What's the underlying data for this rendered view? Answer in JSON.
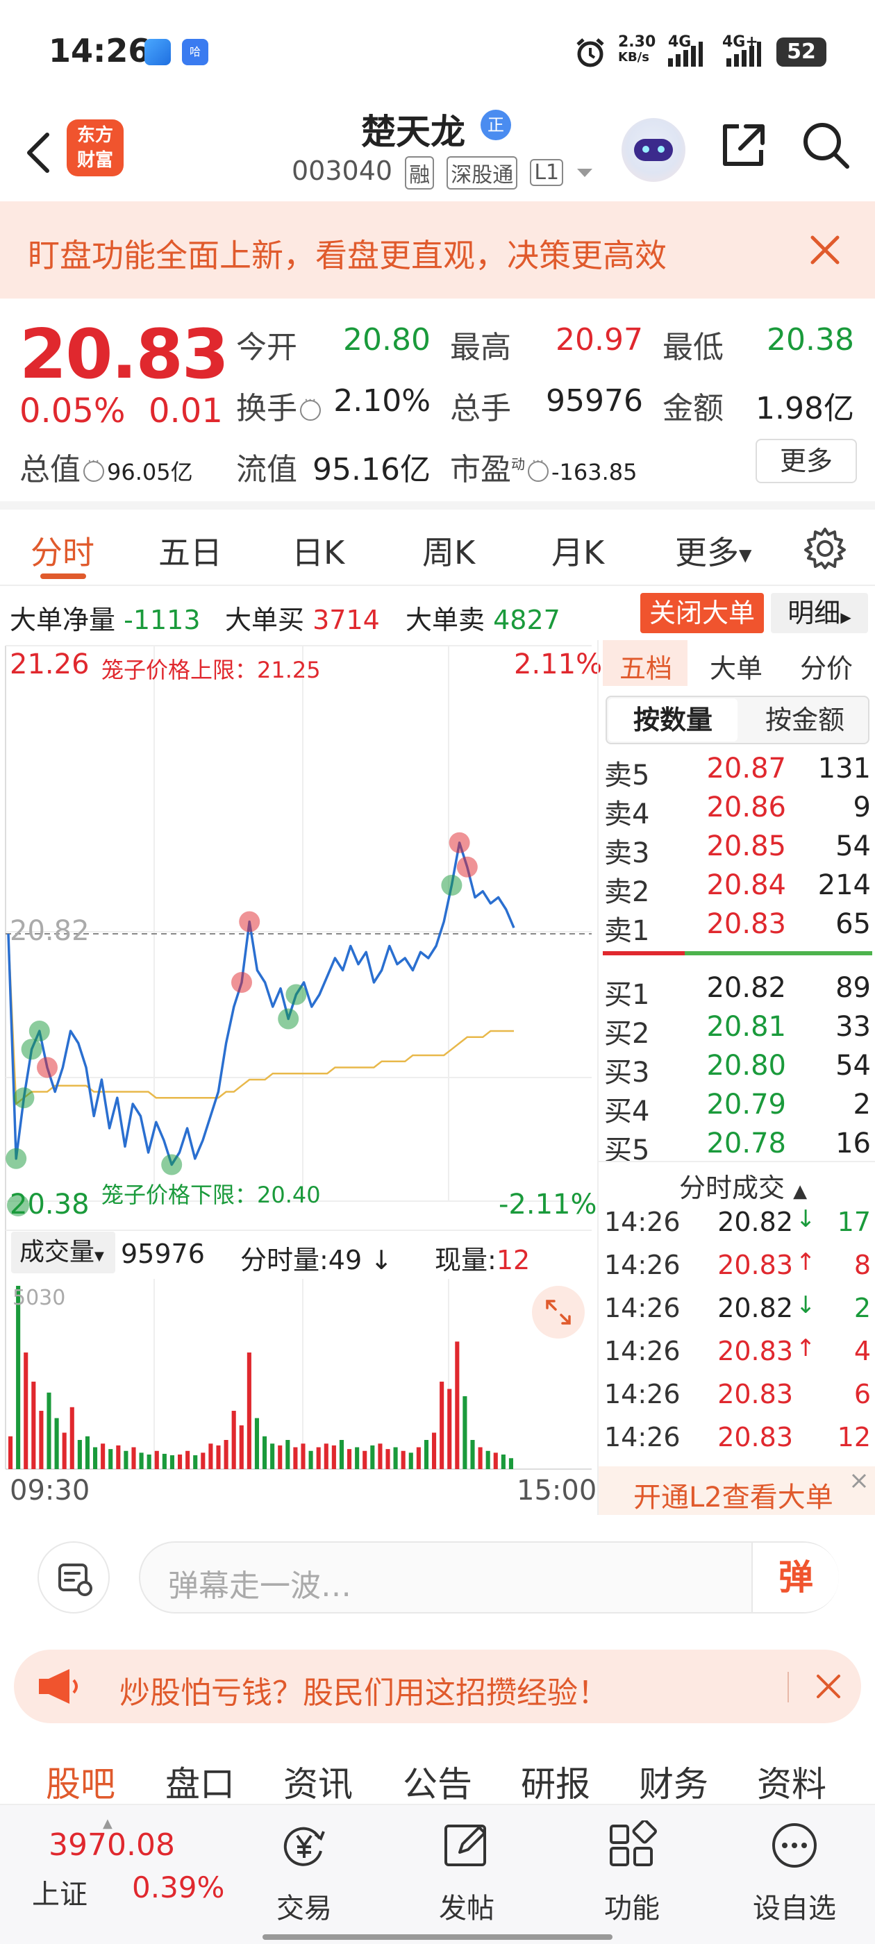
{
  "status_bar": {
    "time": "14:26",
    "net_speed_value": "2.30",
    "net_speed_unit": "KB/s",
    "net1": "4G",
    "net2": "4G+",
    "battery": "52"
  },
  "header": {
    "logo_line1": "东方",
    "logo_line2": "财富",
    "stock_name": "楚天龙",
    "badge": "正",
    "stock_code": "003040",
    "tags": [
      "融",
      "深股通",
      "L1"
    ]
  },
  "banner": {
    "text": "盯盘功能全面上新，看盘更直观，决策更高效"
  },
  "quote": {
    "price": "20.83",
    "change_pct": "0.05%",
    "change_abs": "0.01",
    "open_label": "今开",
    "open": "20.80",
    "high_label": "最高",
    "high": "20.97",
    "low_label": "最低",
    "low": "20.38",
    "turnover_label": "换手",
    "turnover": "2.10%",
    "volume_label": "总手",
    "volume": "95976",
    "amount_label": "金额",
    "amount": "1.98亿",
    "total_mv_label": "总值",
    "total_mv": "96.05亿",
    "float_mv_label": "流值",
    "float_mv": "95.16亿",
    "pe_label": "市盈",
    "pe_sup": "动",
    "pe": "-163.85",
    "more": "更多"
  },
  "tabs": [
    "分时",
    "五日",
    "日K",
    "周K",
    "月K",
    "更多"
  ],
  "big_order": {
    "net_label": "大单净量",
    "net": "-1113",
    "buy_label": "大单买",
    "buy": "3714",
    "sell_label": "大单卖",
    "sell": "4827",
    "close_btn": "关闭大单",
    "detail_btn": "明细"
  },
  "chart": {
    "top_price": "21.26",
    "top_pct": "2.11%",
    "upper_limit": "笼子价格上限：21.25",
    "pre_close": "20.82",
    "bottom_price": "20.38",
    "bottom_pct": "-2.11%",
    "lower_limit": "笼子价格下限：20.40",
    "vol_label": "成交量",
    "vol_total": "95976",
    "vol_minute": "分时量:49",
    "vol_current_label": "现量:",
    "vol_current": "12",
    "vol_max": "5030",
    "time_start": "09:30",
    "time_end": "15:00"
  },
  "chart_data": {
    "type": "line",
    "series": [
      {
        "values": [
          20.82,
          20.45,
          20.55,
          20.63,
          20.66,
          20.6,
          20.56,
          20.6,
          20.66,
          20.64,
          20.6,
          20.52,
          20.58,
          20.5,
          20.55,
          20.47,
          20.54,
          20.52,
          20.46,
          20.51,
          20.48,
          20.44,
          20.46,
          20.5,
          20.45,
          20.48,
          20.52,
          20.56,
          20.64,
          20.7,
          20.74,
          20.84,
          20.76,
          20.74,
          20.7,
          20.73,
          20.68,
          20.72,
          20.74,
          20.7,
          20.72,
          20.75,
          20.78,
          20.76,
          20.8,
          20.77,
          20.79,
          20.74,
          20.76,
          20.8,
          20.77,
          20.78,
          20.76,
          20.79,
          20.78,
          20.8,
          20.84,
          20.9,
          20.97,
          20.93,
          20.88,
          20.89,
          20.87,
          20.88,
          20.86,
          20.83
        ]
      },
      {
        "values": [
          20.82,
          20.54,
          20.55,
          20.56,
          20.56,
          20.56,
          20.57,
          20.57,
          20.57,
          20.57,
          20.57,
          20.56,
          20.56,
          20.56,
          20.56,
          20.56,
          20.56,
          20.56,
          20.56,
          20.55,
          20.55,
          20.55,
          20.55,
          20.55,
          20.55,
          20.55,
          20.55,
          20.55,
          20.56,
          20.56,
          20.57,
          20.58,
          20.58,
          20.58,
          20.59,
          20.59,
          20.59,
          20.59,
          20.59,
          20.59,
          20.59,
          20.59,
          20.6,
          20.6,
          20.6,
          20.6,
          20.6,
          20.6,
          20.61,
          20.61,
          20.61,
          20.61,
          20.62,
          20.62,
          20.62,
          20.62,
          20.62,
          20.63,
          20.64,
          20.65,
          20.65,
          20.65,
          20.66,
          20.66,
          20.66,
          20.66
        ]
      }
    ],
    "ylim": [
      20.38,
      21.26
    ],
    "x_start": "09:30",
    "x_end": "15:00",
    "volume": [
      900,
      5030,
      3200,
      2400,
      1600,
      2100,
      1400,
      1000,
      1700,
      800,
      900,
      600,
      700,
      550,
      650,
      500,
      600,
      450,
      400,
      500,
      420,
      380,
      400,
      500,
      380,
      450,
      700,
      650,
      800,
      1600,
      1200,
      3200,
      1400,
      900,
      700,
      650,
      800,
      600,
      700,
      500,
      600,
      700,
      650,
      800,
      550,
      600,
      500,
      650,
      700,
      550,
      600,
      500,
      450,
      600,
      800,
      1000,
      2400,
      2200,
      3500,
      2000,
      800,
      600,
      500,
      450,
      400,
      300
    ]
  },
  "right_panel": {
    "tabs": [
      "五档",
      "大单",
      "分价"
    ],
    "seg": [
      "按数量",
      "按金额"
    ],
    "asks": [
      {
        "label": "卖5",
        "price": "20.87",
        "vol": "131"
      },
      {
        "label": "卖4",
        "price": "20.86",
        "vol": "9"
      },
      {
        "label": "卖3",
        "price": "20.85",
        "vol": "54"
      },
      {
        "label": "卖2",
        "price": "20.84",
        "vol": "214"
      },
      {
        "label": "卖1",
        "price": "20.83",
        "vol": "65"
      }
    ],
    "bids": [
      {
        "label": "买1",
        "price": "20.82",
        "vol": "89"
      },
      {
        "label": "买2",
        "price": "20.81",
        "vol": "33"
      },
      {
        "label": "买3",
        "price": "20.80",
        "vol": "54"
      },
      {
        "label": "买4",
        "price": "20.79",
        "vol": "2"
      },
      {
        "label": "买5",
        "price": "20.78",
        "vol": "16"
      }
    ],
    "trades_title": "分时成交",
    "trades": [
      {
        "time": "14:26",
        "price": "20.82",
        "arrow": "↓",
        "vol": "17",
        "color": "#222222",
        "vcolor": "#1a9a3b",
        "acolor": "#1a9a3b"
      },
      {
        "time": "14:26",
        "price": "20.83",
        "arrow": "↑",
        "vol": "8",
        "color": "#e0282e",
        "vcolor": "#e0282e",
        "acolor": "#e0282e"
      },
      {
        "time": "14:26",
        "price": "20.82",
        "arrow": "↓",
        "vol": "2",
        "color": "#222222",
        "vcolor": "#1a9a3b",
        "acolor": "#1a9a3b"
      },
      {
        "time": "14:26",
        "price": "20.83",
        "arrow": "↑",
        "vol": "4",
        "color": "#e0282e",
        "vcolor": "#e0282e",
        "acolor": "#e0282e"
      },
      {
        "time": "14:26",
        "price": "20.83",
        "arrow": "",
        "vol": "6",
        "color": "#e0282e",
        "vcolor": "#e0282e",
        "acolor": "#e0282e"
      },
      {
        "time": "14:26",
        "price": "20.83",
        "arrow": "",
        "vol": "12",
        "color": "#e0282e",
        "vcolor": "#e0282e",
        "acolor": "#e0282e"
      }
    ],
    "l2": "开通L2查看大单"
  },
  "comment": {
    "placeholder": "弹幕走一波…",
    "dan": "弹"
  },
  "promo": {
    "text": "炒股怕亏钱？股民们用这招攒经验！"
  },
  "sub_tabs": [
    "股吧",
    "盘口",
    "资讯",
    "公告",
    "研报",
    "财务",
    "资料"
  ],
  "bottom_nav": {
    "index_value": "3970.08",
    "index_name": "上证",
    "index_pct": "0.39%",
    "items": [
      "交易",
      "发帖",
      "功能",
      "设自选"
    ]
  },
  "colors": {
    "up": "#e0282e",
    "down": "#1a9a3b",
    "accent": "#e05a2c",
    "line": "#2a6fd0",
    "avg": "#e8b84a"
  }
}
